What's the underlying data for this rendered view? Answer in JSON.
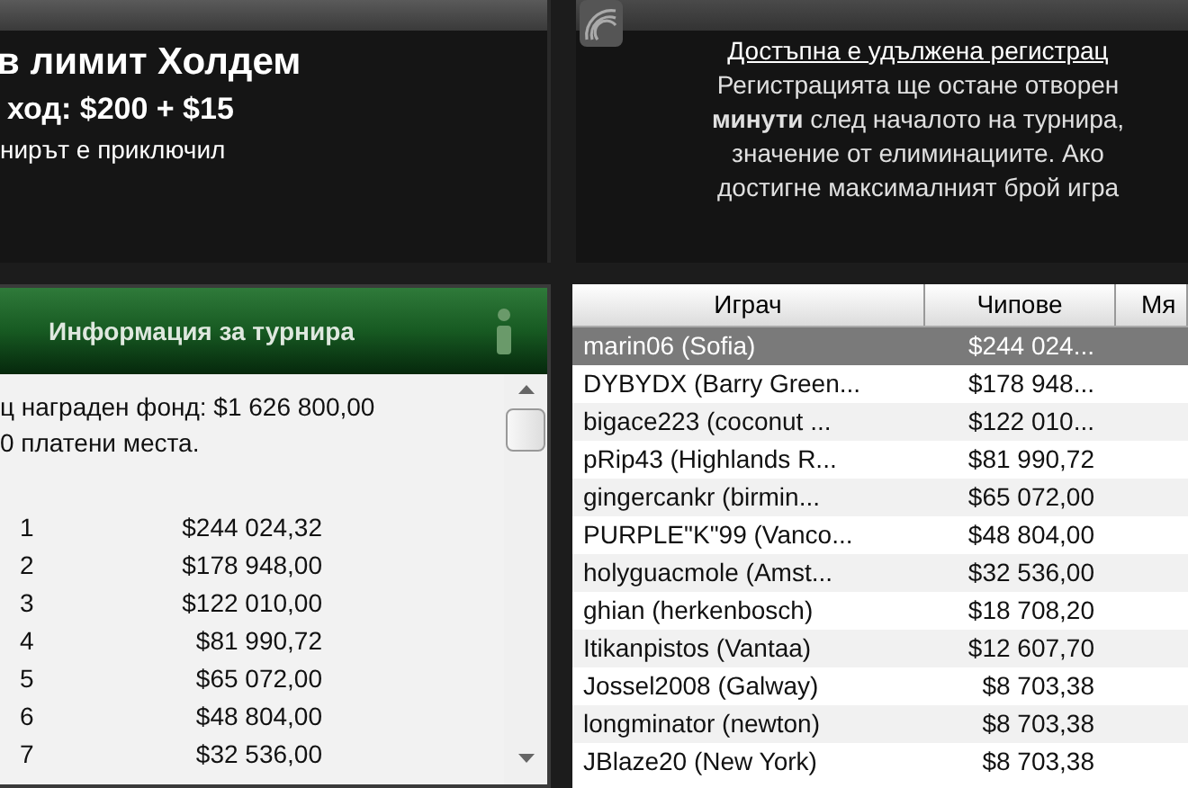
{
  "tournament": {
    "title": "в лимит Холдем",
    "buy_in": "ход: $200 + $15",
    "status": "нирът е приключил"
  },
  "late_registration": {
    "heading": "Достъпна е удължена регистрац",
    "lines": [
      "Регистрацията ще остане отворен",
      "**минути** след началото на турнира,",
      "значение от елиминациите. Ако",
      "достигне максималният брой игра"
    ]
  },
  "info_panel": {
    "title": "Информация за турнира",
    "prize_pool": "ц награден фонд: $1 626 800,00",
    "paid_places": "0 платени места.",
    "payouts": [
      {
        "place": "1",
        "amount": "$244 024,32"
      },
      {
        "place": "2",
        "amount": "$178 948,00"
      },
      {
        "place": "3",
        "amount": "$122 010,00"
      },
      {
        "place": "4",
        "amount": "$81 990,72"
      },
      {
        "place": "5",
        "amount": "$65 072,00"
      },
      {
        "place": "6",
        "amount": "$48 804,00"
      },
      {
        "place": "7",
        "amount": "$32 536,00"
      }
    ]
  },
  "players_table": {
    "columns": [
      "Играч",
      "Чипове",
      "Мя"
    ],
    "rows": [
      {
        "player": "marin06 (Sofia)",
        "chips": "$244 024...",
        "selected": true
      },
      {
        "player": "DYBYDX (Barry Green...",
        "chips": "$178 948...",
        "selected": false
      },
      {
        "player": "bigace223 (coconut ...",
        "chips": "$122 010...",
        "selected": false
      },
      {
        "player": "pRip43 (Highlands R...",
        "chips": "$81 990,72",
        "selected": false
      },
      {
        "player": "gingercankr (birmin...",
        "chips": "$65 072,00",
        "selected": false
      },
      {
        "player": "PURPLE\"K\"99 (Vanco...",
        "chips": "$48 804,00",
        "selected": false
      },
      {
        "player": "holyguacmole (Amst...",
        "chips": "$32 536,00",
        "selected": false
      },
      {
        "player": "ghian (herkenbosch)",
        "chips": "$18 708,20",
        "selected": false
      },
      {
        "player": "Itikanpistos (Vantaa)",
        "chips": "$12 607,70",
        "selected": false
      },
      {
        "player": "Jossel2008 (Galway)",
        "chips": "$8 703,38",
        "selected": false
      },
      {
        "player": "longminator (newton)",
        "chips": "$8 703,38",
        "selected": false
      },
      {
        "player": "JBlaze20 (New York)",
        "chips": "$8 703,38",
        "selected": false
      }
    ]
  }
}
